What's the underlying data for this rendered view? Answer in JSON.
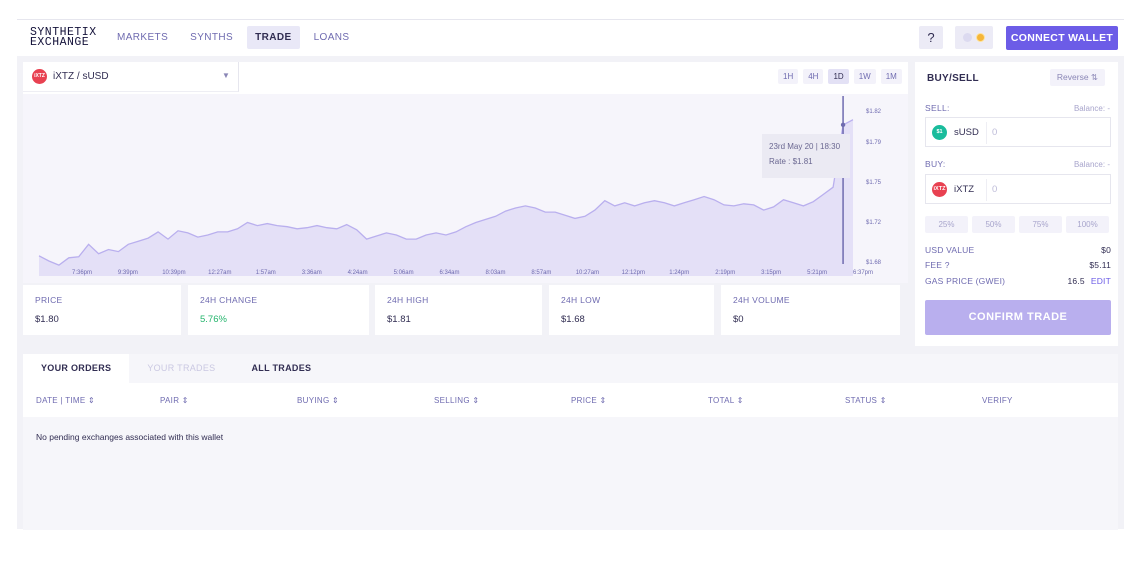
{
  "header": {
    "logo_line1": "SYNTHETIX",
    "logo_line2": "EXCHANGE",
    "nav": [
      {
        "label": "MARKETS",
        "active": false
      },
      {
        "label": "SYNTHS",
        "active": false
      },
      {
        "label": "TRADE",
        "active": true
      },
      {
        "label": "LOANS",
        "active": false
      }
    ],
    "help_label": "?",
    "connect_label": "CONNECT WALLET"
  },
  "chart_panel": {
    "pair": {
      "icon_text": "iXTZ",
      "label": "iXTZ / sUSD"
    },
    "periods": [
      {
        "label": "1H",
        "active": false
      },
      {
        "label": "4H",
        "active": false
      },
      {
        "label": "1D",
        "active": true
      },
      {
        "label": "1W",
        "active": false
      },
      {
        "label": "1M",
        "active": false
      }
    ],
    "tooltip": {
      "date": "23rd May 20 | 18:30",
      "rate": "Rate : $1.81"
    },
    "stats": [
      {
        "label": "PRICE",
        "value": "$1.80",
        "positive": false
      },
      {
        "label": "24H CHANGE",
        "value": "5.76%",
        "positive": true
      },
      {
        "label": "24H HIGH",
        "value": "$1.81",
        "positive": false
      },
      {
        "label": "24H LOW",
        "value": "$1.68",
        "positive": false
      },
      {
        "label": "24H VOLUME",
        "value": "$0",
        "positive": false
      }
    ]
  },
  "chart_data": {
    "type": "area",
    "series": [
      {
        "values": [
          1.674,
          1.669,
          1.665,
          1.672,
          1.673,
          1.685,
          1.676,
          1.68,
          1.678,
          1.685,
          1.688,
          1.691,
          1.697,
          1.69,
          1.698,
          1.696,
          1.692,
          1.694,
          1.697,
          1.697,
          1.7,
          1.706,
          1.703,
          1.705,
          1.703,
          1.702,
          1.7,
          1.701,
          1.703,
          1.701,
          1.7,
          1.704,
          1.699,
          1.69,
          1.693,
          1.696,
          1.694,
          1.69,
          1.69,
          1.694,
          1.696,
          1.694,
          1.697,
          1.702,
          1.706,
          1.709,
          1.712,
          1.717,
          1.72,
          1.722,
          1.72,
          1.716,
          1.716,
          1.713,
          1.71,
          1.712,
          1.718,
          1.727,
          1.722,
          1.725,
          1.722,
          1.725,
          1.727,
          1.725,
          1.722,
          1.725,
          1.728,
          1.731,
          1.728,
          1.723,
          1.722,
          1.724,
          1.723,
          1.718,
          1.721,
          1.728,
          1.725,
          1.722,
          1.726,
          1.733,
          1.74,
          1.8,
          1.805
        ]
      }
    ],
    "x_tick_labels": [
      "7:36pm",
      "9:39pm",
      "10:39pm",
      "12:27am",
      "1:57am",
      "3:36am",
      "4:24am",
      "5:06am",
      "6:34am",
      "8:03am",
      "8:57am",
      "10:27am",
      "12:12pm",
      "1:24pm",
      "2:19pm",
      "3:15pm",
      "5:21pm",
      "6:37pm"
    ],
    "y_tick_labels": [
      "$1.82",
      "$1.79",
      "$1.75",
      "$1.72",
      "$1.68"
    ],
    "ylim": [
      1.668,
      1.822
    ],
    "grid": false,
    "line_color": "#b9afee",
    "fill_color": "#e4e0f7"
  },
  "trade_panel": {
    "title": "BUY/SELL",
    "reverse_label": "Reverse ⇅",
    "sell_label": "SELL:",
    "sell_balance": "Balance: -",
    "sell_token": {
      "icon_text": "$1",
      "name": "sUSD",
      "amount": "0",
      "color": "#1abc9c"
    },
    "buy_label": "BUY:",
    "buy_balance": "Balance: -",
    "buy_token": {
      "icon_text": "iXTZ",
      "name": "iXTZ",
      "amount": "0",
      "color": "#e84151"
    },
    "pct_buttons": [
      "25%",
      "50%",
      "75%",
      "100%"
    ],
    "usd_value_label": "USD VALUE",
    "usd_value": "$0",
    "fee_label": "FEE ?",
    "fee_value": "$5.11",
    "gas_label": "GAS PRICE (GWEI)",
    "gas_value": "16.5",
    "edit_label": "EDIT",
    "confirm_label": "CONFIRM TRADE"
  },
  "orders": {
    "tabs": [
      {
        "label": "YOUR ORDERS",
        "state": "active"
      },
      {
        "label": "YOUR TRADES",
        "state": "dim"
      },
      {
        "label": "ALL TRADES",
        "state": "normal"
      }
    ],
    "columns": [
      "DATE | TIME ⇕",
      "PAIR ⇕",
      "BUYING ⇕",
      "SELLING ⇕",
      "PRICE ⇕",
      "TOTAL ⇕",
      "STATUS ⇕",
      "VERIFY"
    ],
    "empty_message": "No pending exchanges associated with this wallet"
  }
}
